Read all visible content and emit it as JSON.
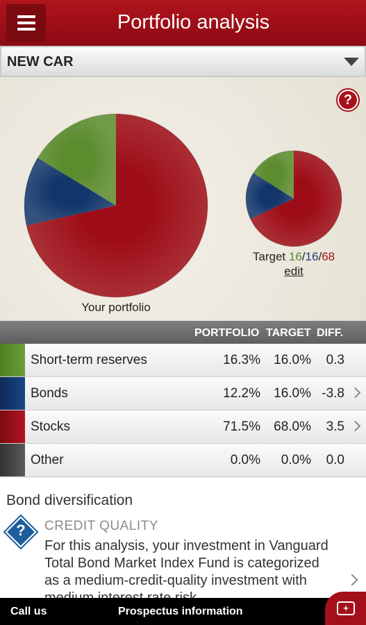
{
  "header": {
    "title": "Portfolio analysis"
  },
  "selector": {
    "value": "NEW CAR"
  },
  "colors": {
    "short_term": "#5b8c2e",
    "bonds": "#12366b",
    "stocks": "#9e0d17",
    "other": "#444444",
    "accent": "#a3101b"
  },
  "chart_data": [
    {
      "type": "pie",
      "title": "Your portfolio",
      "labels": [
        "Short-term reserves",
        "Bonds",
        "Stocks"
      ],
      "values": [
        16.3,
        12.2,
        71.5
      ]
    },
    {
      "type": "pie",
      "title": "",
      "labels": [
        "Short-term reserves",
        "Bonds",
        "Stocks"
      ],
      "values": [
        16,
        16,
        68
      ]
    }
  ],
  "portfolio_caption": "Your portfolio",
  "target_caption": {
    "prefix": "Target ",
    "green": "16",
    "blue": "16",
    "red": "68",
    "sep": "/",
    "edit": "edit"
  },
  "table": {
    "headers": [
      "PORTFOLIO",
      "TARGET",
      "DIFF."
    ],
    "rows": [
      {
        "label": "Short-term reserves",
        "portfolio": "16.3%",
        "target": "16.0%",
        "diff": "0.3"
      },
      {
        "label": "Bonds",
        "portfolio": "12.2%",
        "target": "16.0%",
        "diff": "-3.8"
      },
      {
        "label": "Stocks",
        "portfolio": "71.5%",
        "target": "68.0%",
        "diff": "3.5"
      },
      {
        "label": "Other",
        "portfolio": "0.0%",
        "target": "0.0%",
        "diff": "0.0"
      }
    ]
  },
  "bond": {
    "title": "Bond diversification",
    "credit_heading": "CREDIT QUALITY",
    "credit_body": "For this analysis, your investment in Vanguard Total Bond Market Index Fund is categorized as a medium-credit-quality investment with medium interest rate risk."
  },
  "footer": {
    "call": "Call us",
    "prospectus": "Prospectus information"
  },
  "icons": {
    "menu": "menu-icon",
    "help": "help-icon",
    "chat": "chat-icon"
  }
}
